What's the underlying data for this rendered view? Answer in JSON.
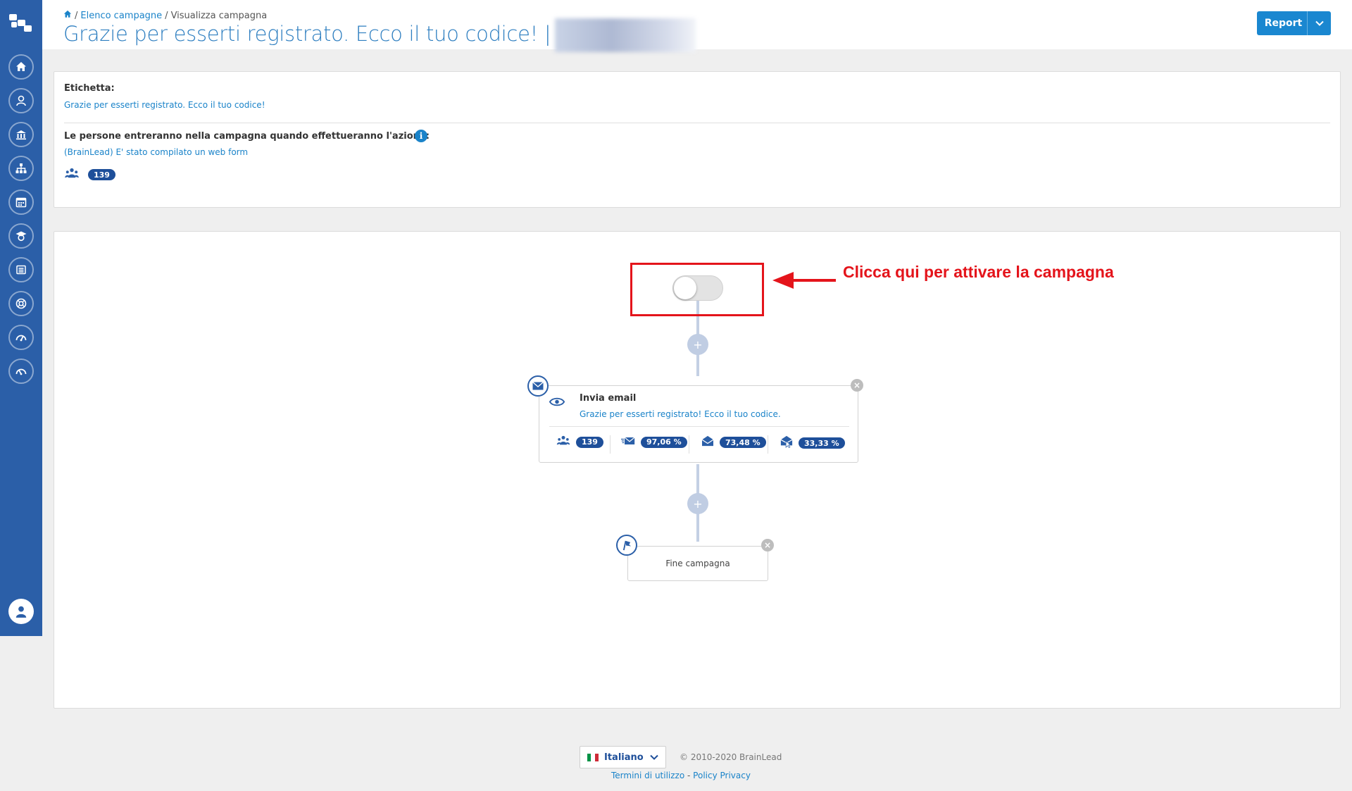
{
  "breadcrumb": {
    "home_icon": "home-icon",
    "campaigns_link": "Elenco campagne",
    "separator": "/",
    "current": "Visualizza campagna"
  },
  "page_title": "Grazie per esserti registrato. Ecco il tuo codice! |",
  "header": {
    "report_label": "Report"
  },
  "info": {
    "tag_label": "Etichetta:",
    "tag_value": "Grazie per esserti registrato. Ecco il tuo codice!",
    "entry_label": "Le persone entreranno nella campagna quando effettueranno l'azione:",
    "entry_value": "(BrainLead) E' stato compilato un web form",
    "people_count": "139"
  },
  "flow": {
    "annotation": "Clicca qui per attivare la campagna",
    "toggle_on": false,
    "plus_label": "+",
    "email_node": {
      "title": "Invia email",
      "subject": "Grazie per esserti registrato! Ecco il tuo codice.",
      "stats": [
        {
          "icon": "people-icon",
          "value": "139"
        },
        {
          "icon": "sent-mail-icon",
          "value": "97,06 %"
        },
        {
          "icon": "open-mail-icon",
          "value": "73,48 %"
        },
        {
          "icon": "click-mail-icon",
          "value": "33,33 %"
        }
      ]
    },
    "end_node": {
      "title": "Fine campagna"
    },
    "close_label": "×"
  },
  "footer": {
    "language": "Italiano",
    "copyright": "© 2010-2020 BrainLead",
    "terms": "Termini di utilizzo",
    "link_separator": " - ",
    "privacy": "Policy Privacy"
  },
  "colors": {
    "sidebar": "#2b5fa8",
    "accent": "#1a83c9",
    "badge": "#1e4f9a",
    "annotation": "#e4141b"
  }
}
